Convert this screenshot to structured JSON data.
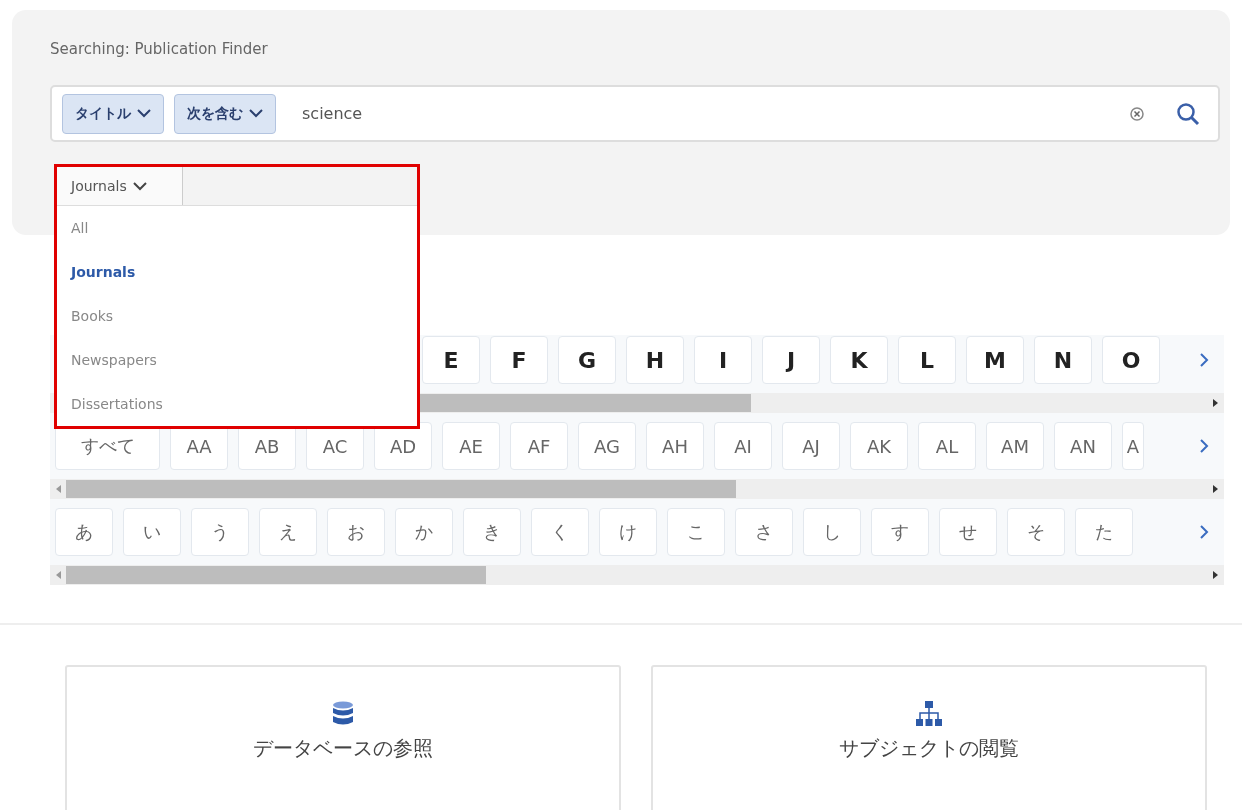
{
  "search_panel": {
    "title": "Searching: Publication Finder",
    "field_selects": [
      "タイトル",
      "次を含む"
    ],
    "query": "science",
    "type_dropdown": {
      "label": "Journals",
      "expanded": true,
      "options": [
        {
          "label": "All",
          "selected": false
        },
        {
          "label": "Journals",
          "selected": true
        },
        {
          "label": "Books",
          "selected": false
        },
        {
          "label": "Newspapers",
          "selected": false
        },
        {
          "label": "Dissertations",
          "selected": false
        }
      ]
    }
  },
  "letter_rows": [
    {
      "kind": "latin",
      "keys": [
        "E",
        "F",
        "G",
        "H",
        "I",
        "J",
        "K",
        "L",
        "M",
        "N",
        "O"
      ]
    },
    {
      "kind": "pair",
      "keys": [
        "すべて",
        "AA",
        "AB",
        "AC",
        "AD",
        "AE",
        "AF",
        "AG",
        "AH",
        "AI",
        "AJ",
        "AK",
        "AL",
        "AM",
        "AN",
        "A"
      ]
    },
    {
      "kind": "kana",
      "keys": [
        "あ",
        "い",
        "う",
        "え",
        "お",
        "か",
        "き",
        "く",
        "け",
        "こ",
        "さ",
        "し",
        "す",
        "せ",
        "そ",
        "た"
      ]
    }
  ],
  "browse_cards": [
    {
      "kind": "database",
      "label": "データベースの参照"
    },
    {
      "kind": "subject",
      "label": "サブジェクトの閲覧"
    }
  ]
}
